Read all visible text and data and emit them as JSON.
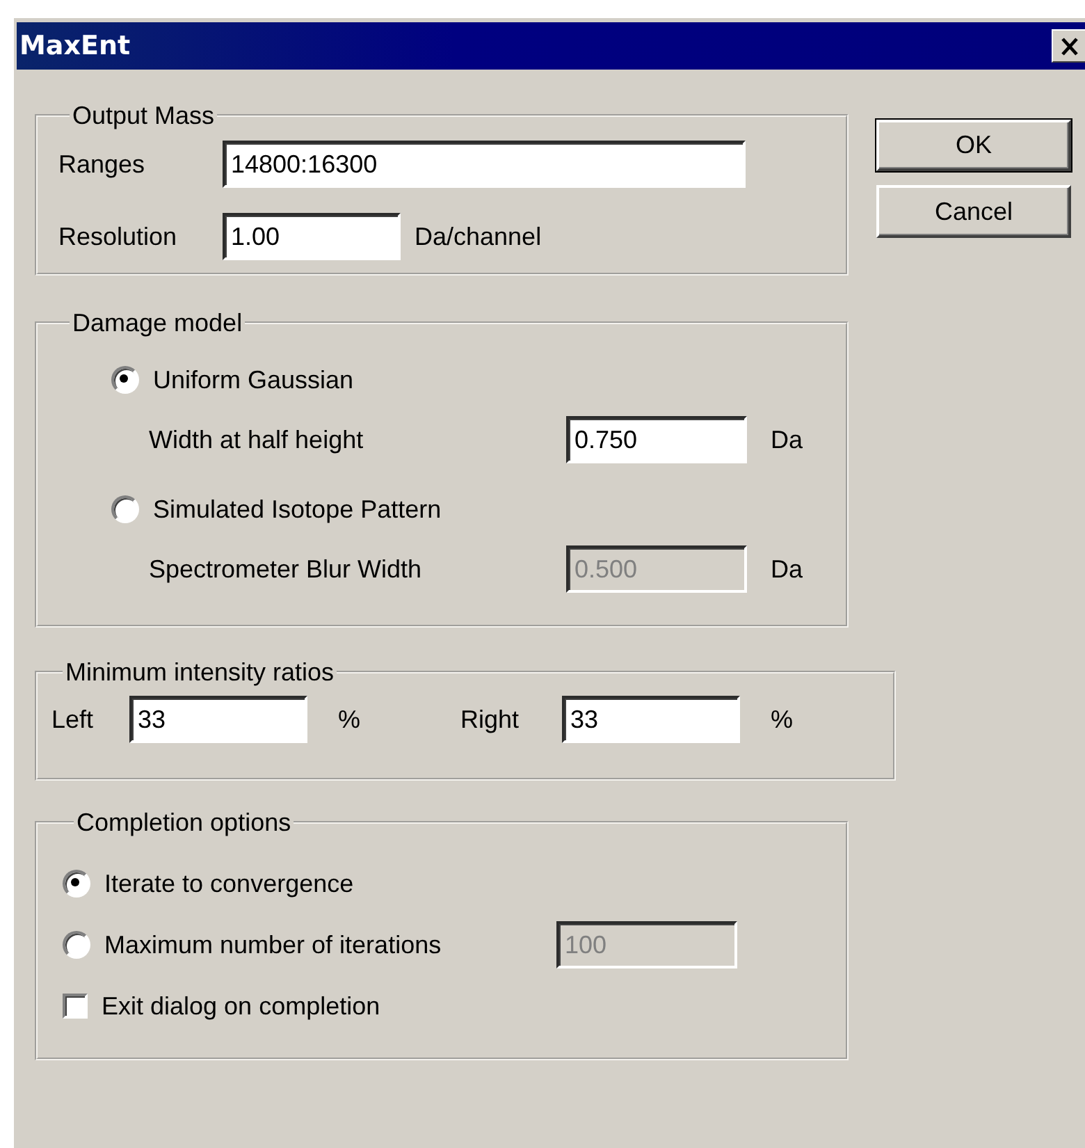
{
  "window": {
    "title": "MaxEnt"
  },
  "output_mass": {
    "title": "Output Mass",
    "ranges": {
      "label": "Ranges",
      "value": "14800:16300"
    },
    "resolution": {
      "label": "Resolution",
      "value": "1.00",
      "unit": "Da/channel"
    }
  },
  "damage_model": {
    "title": "Damage model",
    "options": [
      {
        "label": "Uniform Gaussian",
        "selected": true,
        "field": {
          "label": "Width at half height",
          "value": "0.750",
          "unit": "Da",
          "disabled": false
        }
      },
      {
        "label": "Simulated Isotope Pattern",
        "selected": false,
        "field": {
          "label": "Spectrometer Blur Width",
          "value": "0.500",
          "unit": "Da",
          "disabled": true
        }
      }
    ]
  },
  "intensity": {
    "title": "Minimum intensity ratios",
    "fields": [
      {
        "label": "Left",
        "value": "33",
        "unit": "%"
      },
      {
        "label": "Right",
        "value": "33",
        "unit": "%"
      }
    ]
  },
  "completion": {
    "title": "Completion options",
    "options": [
      {
        "label": "Iterate to convergence",
        "selected": true
      },
      {
        "label": "Maximum number of iterations",
        "selected": false,
        "field": {
          "value": "100",
          "disabled": true
        }
      }
    ],
    "exit_on_completion": {
      "label": "Exit dialog on completion",
      "checked": false
    }
  },
  "buttons": [
    {
      "label": "OK",
      "default": true
    },
    {
      "label": "Cancel",
      "default": false
    }
  ]
}
